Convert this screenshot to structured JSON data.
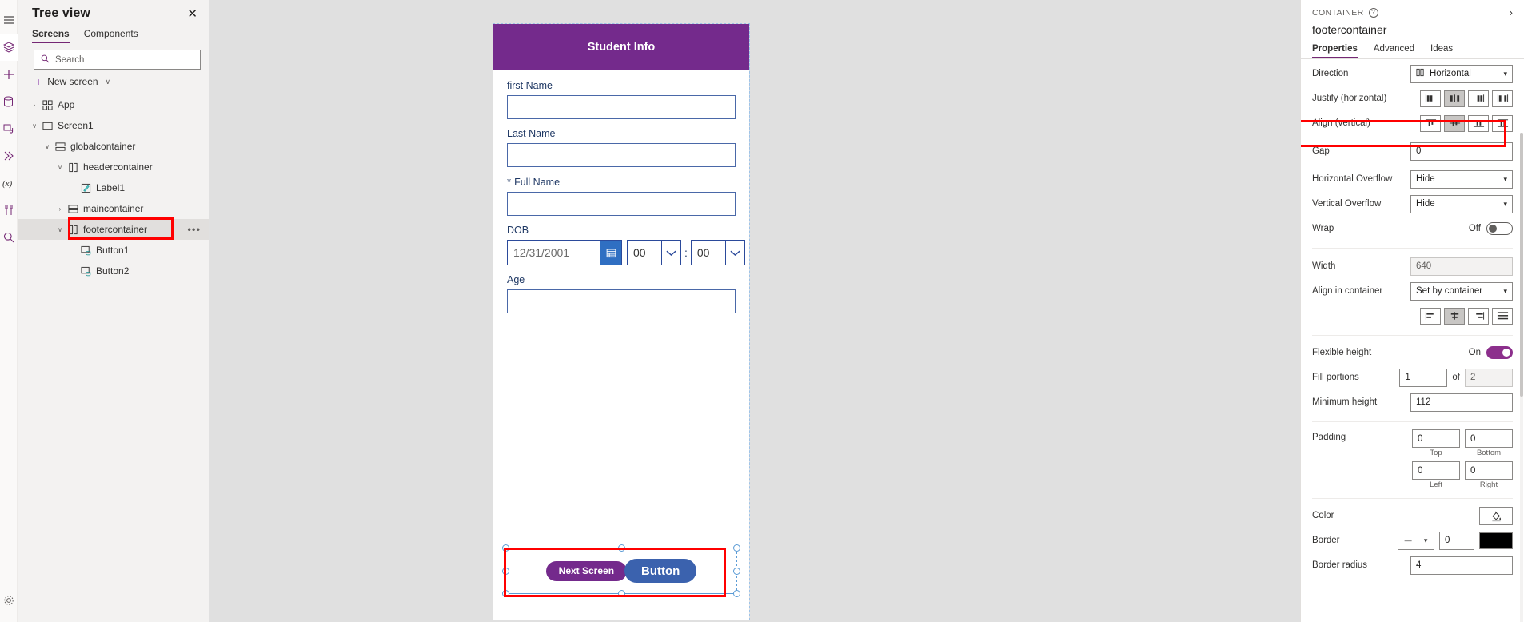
{
  "rail": {
    "items": [
      {
        "name": "hamburger-menu",
        "label": "Menu"
      },
      {
        "name": "tree-view",
        "label": "Tree view"
      },
      {
        "name": "insert",
        "label": "Insert"
      },
      {
        "name": "data",
        "label": "Data"
      },
      {
        "name": "media",
        "label": "Media"
      },
      {
        "name": "power-automate",
        "label": "Power Automate"
      },
      {
        "name": "variables",
        "label": "Variables"
      },
      {
        "name": "tools",
        "label": "Advanced tools"
      },
      {
        "name": "search",
        "label": "Search"
      }
    ],
    "settings_label": "Settings"
  },
  "tree": {
    "title": "Tree view",
    "close_label": "✕",
    "tabs": [
      {
        "label": "Screens",
        "active": true
      },
      {
        "label": "Components",
        "active": false
      }
    ],
    "search": {
      "placeholder": "Search",
      "value": "",
      "icon": "search-icon"
    },
    "new_screen": {
      "label": "New screen",
      "plus": "+",
      "chevron": "∨"
    },
    "nodes": [
      {
        "label": "App",
        "indent": 0,
        "chevron": "›",
        "icon": "app-icon",
        "selected": false,
        "dots": false
      },
      {
        "label": "Screen1",
        "indent": 0,
        "chevron": "∨",
        "icon": "screen-icon",
        "selected": false,
        "dots": false
      },
      {
        "label": "globalcontainer",
        "indent": 1,
        "chevron": "∨",
        "icon": "vcontainer-icon",
        "selected": false,
        "dots": false
      },
      {
        "label": "headercontainer",
        "indent": 2,
        "chevron": "∨",
        "icon": "hcontainer-icon",
        "selected": false,
        "dots": false
      },
      {
        "label": "Label1",
        "indent": 3,
        "chevron": "",
        "icon": "label-icon",
        "selected": false,
        "dots": false
      },
      {
        "label": "maincontainer",
        "indent": 2,
        "chevron": "›",
        "icon": "vcontainer-icon",
        "selected": false,
        "dots": false
      },
      {
        "label": "footercontainer",
        "indent": 2,
        "chevron": "∨",
        "icon": "hcontainer-icon",
        "selected": true,
        "dots": true
      },
      {
        "label": "Button1",
        "indent": 3,
        "chevron": "",
        "icon": "button-icon",
        "selected": false,
        "dots": false
      },
      {
        "label": "Button2",
        "indent": 3,
        "chevron": "",
        "icon": "button-icon",
        "selected": false,
        "dots": false
      }
    ]
  },
  "canvas": {
    "app_header_title": "Student Info",
    "fields": [
      {
        "label": "first Name",
        "required": "",
        "value": "",
        "type": "text"
      },
      {
        "label": "Last Name",
        "required": "",
        "value": "",
        "type": "text"
      },
      {
        "label": "Full Name",
        "required": "*",
        "value": "",
        "type": "text"
      },
      {
        "label": "Age",
        "required": "",
        "value": "",
        "type": "text"
      }
    ],
    "dob": {
      "label": "DOB",
      "date_value": "12/31/2001",
      "calendar_icon": "calendar-icon",
      "hour_value": "00",
      "minute_value": "00",
      "separator": ":"
    },
    "footer_buttons": [
      {
        "label": "Next Screen",
        "style": "purple"
      },
      {
        "label": "Button",
        "style": "blue"
      }
    ]
  },
  "properties": {
    "kicker": "CONTAINER",
    "help_icon": "question-icon",
    "collapse_icon": "chevron-right-icon",
    "control_name": "footercontainer",
    "tabs": [
      {
        "label": "Properties",
        "active": true
      },
      {
        "label": "Advanced",
        "active": false
      },
      {
        "label": "Ideas",
        "active": false
      }
    ],
    "rows": {
      "direction": {
        "label": "Direction",
        "value": "Horizontal"
      },
      "justify": {
        "label": "Justify (horizontal)",
        "selected_index": 1
      },
      "align": {
        "label": "Align (vertical)",
        "selected_index": 1
      },
      "gap": {
        "label": "Gap",
        "value": "0"
      },
      "hoverflow": {
        "label": "Horizontal Overflow",
        "value": "Hide"
      },
      "voverflow": {
        "label": "Vertical Overflow",
        "value": "Hide"
      },
      "wrap": {
        "label": "Wrap",
        "state": "Off",
        "on": false
      },
      "width": {
        "label": "Width",
        "value": "640"
      },
      "aligncont": {
        "label": "Align in container",
        "value": "Set by container",
        "selected_index": 1
      },
      "flexheight": {
        "label": "Flexible height",
        "state": "On",
        "on": true
      },
      "fill": {
        "label": "Fill portions",
        "value": "1",
        "of_label": "of",
        "of_value": "2"
      },
      "minheight": {
        "label": "Minimum height",
        "value": "112"
      },
      "padding": {
        "label": "Padding",
        "top": "0",
        "bottom": "0",
        "left": "0",
        "right": "0",
        "top_caption": "Top",
        "bottom_caption": "Bottom",
        "left_caption": "Left",
        "right_caption": "Right"
      },
      "color": {
        "label": "Color",
        "icon": "fill-bucket-icon"
      },
      "border": {
        "label": "Border",
        "style": "—",
        "width": "0",
        "color": "#000000"
      },
      "borderradius": {
        "label": "Border radius",
        "value": "4"
      }
    }
  },
  "colors": {
    "accent_purple": "#742774",
    "app_header": "#742a8c",
    "highlight_red": "#ff0000",
    "button_blue": "#3b62ae",
    "field_border": "#2b4a9b",
    "selection_blue": "#5b9bd5"
  }
}
